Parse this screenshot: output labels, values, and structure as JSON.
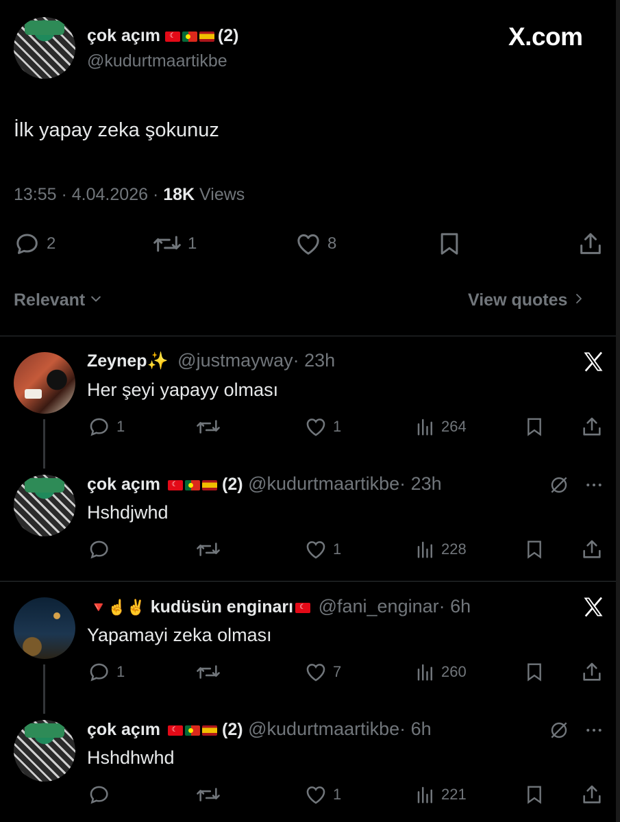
{
  "main_tweet": {
    "display_name": "çok açım",
    "name_suffix": "(2)",
    "handle": "@kudurtmaartikbe",
    "watermark": "X.com",
    "text": "İlk yapay zeka şokunuz",
    "time": "13:55 · 4.04.2026 · ",
    "views_count": "18K",
    "views_label": " Views",
    "actions": {
      "replies": "2",
      "reposts": "1",
      "likes": "8"
    }
  },
  "sort": {
    "label": "Relevant",
    "view_quotes": "View quotes"
  },
  "replies": [
    {
      "display_name": "Zeynep✨",
      "handle": "@justmayway",
      "time": "· 23h",
      "text": "Her şeyi yapayy olması",
      "replies": "1",
      "reposts": "",
      "likes": "1",
      "views": "264"
    },
    {
      "display_name": "çok açım",
      "name_suffix": "(2)",
      "handle": "@kudurtmaartikbe",
      "time": "· 23h",
      "text": "Hshdjwhd",
      "replies": "",
      "reposts": "",
      "likes": "1",
      "views": "228"
    },
    {
      "display_name_prefix": "🔻☝️✌️",
      "display_name": "kudüsün enginarı",
      "handle": "@fani_enginar",
      "time": "· 6h",
      "text": "Yapamayi zeka olması",
      "replies": "1",
      "reposts": "",
      "likes": "7",
      "views": "260"
    },
    {
      "display_name": "çok açım",
      "name_suffix": "(2)",
      "handle": "@kudurtmaartikbe",
      "time": "· 6h",
      "text": "Hshdhwhd",
      "replies": "",
      "reposts": "",
      "likes": "1",
      "views": "221"
    }
  ],
  "colors": {
    "background": "#000000",
    "text": "#e7e9ea",
    "muted": "#71767b",
    "divider": "#2f3336"
  }
}
